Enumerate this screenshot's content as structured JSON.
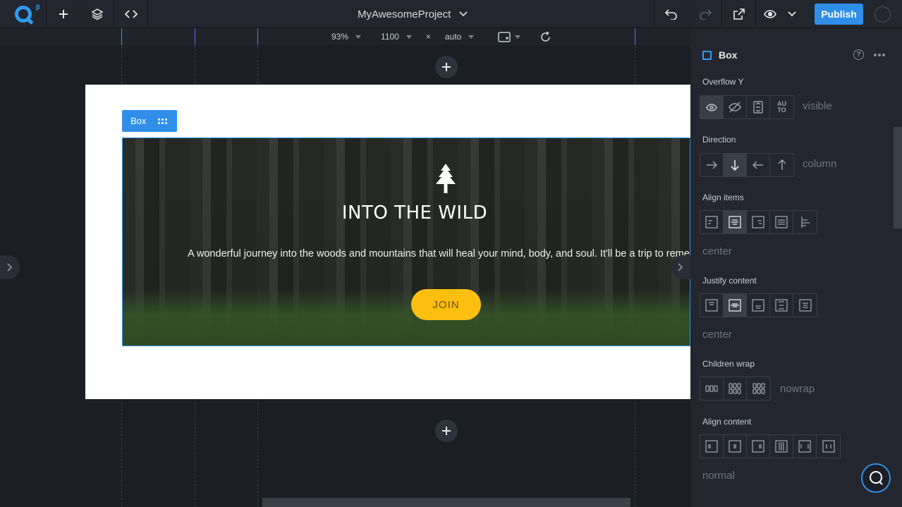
{
  "app": {
    "logo_beta": "β",
    "project_name": "MyAwesomeProject",
    "publish_label": "Publish"
  },
  "toolbar_left": {
    "icons": [
      "add-icon",
      "layers-icon",
      "code-icon"
    ]
  },
  "toolbar_right": {
    "icons": [
      "undo-icon",
      "redo-icon",
      "external-link-icon",
      "eye-icon",
      "chevron-down-icon"
    ]
  },
  "view": {
    "zoom": "93%",
    "width": "1100",
    "times": "×",
    "height": "auto"
  },
  "canvas": {
    "box_label": "Box",
    "hero": {
      "title": "INTO THE WILD",
      "text": "A wonderful journey into the woods and mountains that will heal your mind, body, and soul. It'll be a trip to remem",
      "join_label": "JOIN"
    }
  },
  "panel": {
    "title": "Box",
    "overflow_y": {
      "label": "Overflow Y",
      "value": "visible",
      "options": [
        "visible-icon",
        "hidden-icon",
        "scroll-icon",
        "auto"
      ],
      "auto_text_1": "AU",
      "auto_text_2": "TO"
    },
    "direction": {
      "label": "Direction",
      "value": "column"
    },
    "align_items": {
      "label": "Align items",
      "value": "center"
    },
    "justify_content": {
      "label": "Justify content",
      "value": "center"
    },
    "children_wrap": {
      "label": "Children wrap",
      "value": "nowrap"
    },
    "align_content": {
      "label": "Align content",
      "value": "normal"
    }
  },
  "colors": {
    "accent": "#2f8fe8",
    "join_button": "#fcbf0f",
    "panel_bg": "#23262e",
    "canvas_bg": "#1b1e25"
  }
}
